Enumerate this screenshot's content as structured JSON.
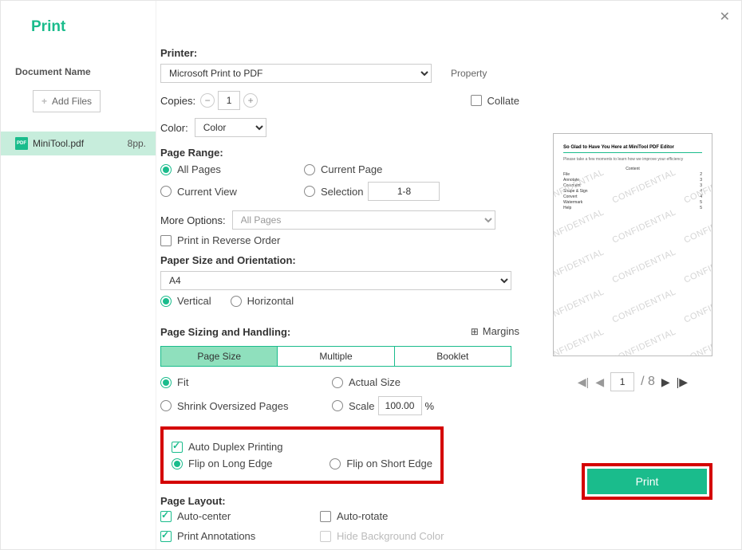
{
  "dialog_title": "Print",
  "sidebar": {
    "doc_label": "Document Name",
    "add_files": "Add Files",
    "file": {
      "name": "MiniTool.pdf",
      "pages": "8pp."
    }
  },
  "printer": {
    "label": "Printer:",
    "value": "Microsoft Print to PDF",
    "property": "Property"
  },
  "copies": {
    "label": "Copies:",
    "value": "1"
  },
  "collate": "Collate",
  "color": {
    "label": "Color:",
    "value": "Color"
  },
  "page_range": {
    "label": "Page Range:",
    "all": "All Pages",
    "current_page": "Current Page",
    "current_view": "Current View",
    "selection": "Selection",
    "selection_value": "1-8"
  },
  "more_options": {
    "label": "More Options:",
    "value": "All Pages"
  },
  "reverse": "Print in Reverse Order",
  "paper": {
    "label": "Paper Size and Orientation:",
    "size": "A4",
    "vertical": "Vertical",
    "horizontal": "Horizontal"
  },
  "sizing": {
    "label": "Page Sizing and Handling:",
    "margins": "Margins",
    "tabs": {
      "page_size": "Page Size",
      "multiple": "Multiple",
      "booklet": "Booklet"
    },
    "fit": "Fit",
    "actual": "Actual Size",
    "shrink": "Shrink Oversized Pages",
    "scale": "Scale",
    "scale_value": "100.00",
    "percent": "%"
  },
  "duplex": {
    "auto": "Auto Duplex Printing",
    "long": "Flip on Long Edge",
    "short": "Flip on Short Edge"
  },
  "layout": {
    "label": "Page Layout:",
    "auto_center": "Auto-center",
    "auto_rotate": "Auto-rotate",
    "annotations": "Print Annotations",
    "hide_bg": "Hide Background Color"
  },
  "preview": {
    "title": "So Glad to Have You Here at MiniTool PDF Editor",
    "sub": "Please take a few moments to learn how we improve your efficiency",
    "toc_head": "Content",
    "toc": [
      {
        "t": "File",
        "p": "2"
      },
      {
        "t": "Annotate",
        "p": "3"
      },
      {
        "t": "Comment",
        "p": "3"
      },
      {
        "t": "Shape & Sign",
        "p": "4"
      },
      {
        "t": "Convert",
        "p": "4"
      },
      {
        "t": "Watermark",
        "p": "5"
      },
      {
        "t": "Help",
        "p": "5"
      }
    ],
    "wm": "CONFIDENTIAL",
    "page": "1",
    "total": "/ 8"
  },
  "print_button": "Print"
}
